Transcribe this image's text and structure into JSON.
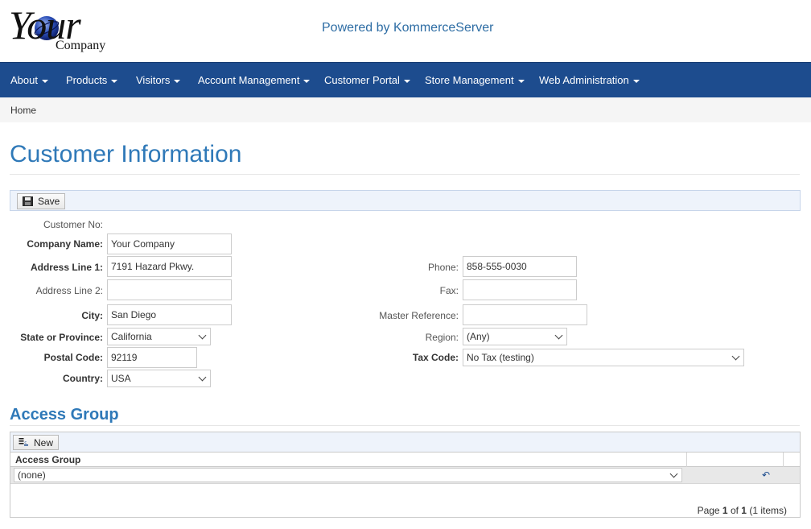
{
  "header": {
    "logo_text": "Your",
    "logo_sub": "Company",
    "powered": "Powered by KommerceServer"
  },
  "nav": [
    {
      "label": "About"
    },
    {
      "label": "Products"
    },
    {
      "label": "Visitors"
    },
    {
      "label": "Account Management"
    },
    {
      "label": "Customer Portal"
    },
    {
      "label": "Store Management"
    },
    {
      "label": "Web Administration"
    }
  ],
  "breadcrumb": "Home",
  "page_title": "Customer Information",
  "toolbar": {
    "save_label": "Save",
    "save_icon": "floppy-disk-icon"
  },
  "form": {
    "customer_no": {
      "label": "Customer No:",
      "value": ""
    },
    "company_name": {
      "label": "Company Name:",
      "value": "Your Company"
    },
    "address1": {
      "label": "Address Line 1:",
      "value": "7191 Hazard Pkwy."
    },
    "address2": {
      "label": "Address Line 2:",
      "value": ""
    },
    "city": {
      "label": "City:",
      "value": "San Diego"
    },
    "state": {
      "label": "State or Province:",
      "value": "California"
    },
    "postal": {
      "label": "Postal Code:",
      "value": "92119"
    },
    "country": {
      "label": "Country:",
      "value": "USA"
    },
    "phone": {
      "label": "Phone:",
      "value": "858-555-0030"
    },
    "fax": {
      "label": "Fax:",
      "value": ""
    },
    "master_ref": {
      "label": "Master Reference:",
      "value": ""
    },
    "region": {
      "label": "Region:",
      "value": "(Any)"
    },
    "tax_code": {
      "label": "Tax Code:",
      "value": "No Tax (testing)"
    }
  },
  "access_group": {
    "title": "Access Group",
    "new_label": "New",
    "column": "Access Group",
    "row_value": "(none)",
    "undo_icon": "undo-icon",
    "pager": {
      "prefix": "Page ",
      "page": "1",
      "of": " of ",
      "total": "1",
      "items": " (1 items)"
    }
  },
  "colors": {
    "nav_bg": "#1d4c8e",
    "title": "#2f79b8",
    "toolbar_bg": "#eef3fb"
  }
}
